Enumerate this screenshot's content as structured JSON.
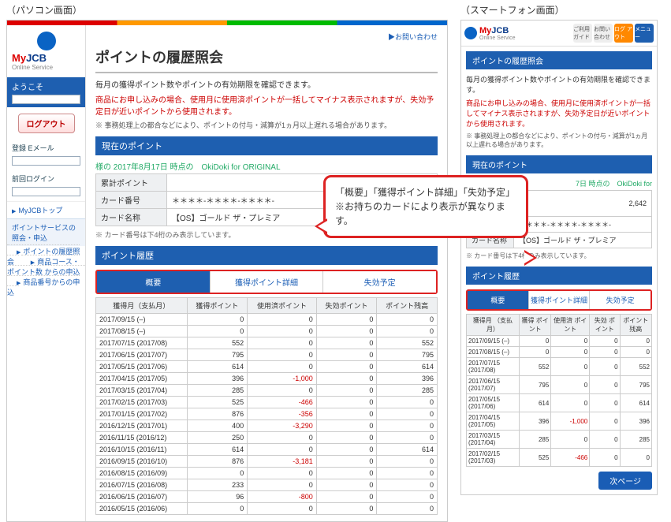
{
  "labels": {
    "pc": "（パソコン画面）",
    "sp": "（スマートフォン画面）"
  },
  "logo": {
    "brand_my": "My",
    "brand_jcb": "JCB",
    "sub": "Online Service"
  },
  "side": {
    "welcome": "ようこそ",
    "logout": "ログアウト",
    "email": "登録 Eメール",
    "last_login": "前回ログイン",
    "top": "MyJCBトップ",
    "point_service": "ポイントサービスの\n照会・申込",
    "links": [
      "ポイントの履歴照会",
      "商品コース・ポイント数\nからの申込",
      "商品番号からの申込"
    ]
  },
  "crumb": "▶お問い合わせ",
  "title": "ポイントの履歴照会",
  "lead": "毎月の獲得ポイント数やポイントの有効期限を確認できます。",
  "warn": "商品にお申し込みの場合、使用月に使用済ポイントが一括してマイナス表示されますが、失効予定日が近いポイントから使用されます。",
  "warn_sp": "商品にお申し込みの場合、使用月に使用済ポイントが一括してマイナス表示されますが、失効予定日が近いポイントから使用されます。",
  "note": "※ 事務処理上の都合などにより、ポイントの付与・減算が1ヵ月以上遅れる場合があります。",
  "sec_current": "現在のポイント",
  "card_line": "様の 2017年8月17日 時点の　OkiDoki for ORIGINAL",
  "card_line_sp": "7日 時点の　OkiDoki for",
  "card": {
    "rows": [
      {
        "k": "累計ポイント",
        "v": "2,642"
      },
      {
        "k": "カード番号",
        "v": "＊＊＊＊-＊＊＊＊-＊＊＊＊-"
      },
      {
        "k": "カード名称",
        "v": "【OS】ゴールド ザ・プレミア"
      }
    ],
    "note": "※ カード番号は下4桁のみ表示しています。"
  },
  "sec_history": "ポイント履歴",
  "tabs": [
    "概要",
    "獲得ポイント詳細",
    "失効予定"
  ],
  "cols": [
    "獲得月（支払月）",
    "獲得ポイント",
    "使用済ポイント",
    "失効ポイント",
    "ポイント残高"
  ],
  "cols_sp": [
    "獲得月\n（支払月）",
    "獲得\nポイント",
    "使用済\nポイント",
    "失効\nポイント",
    "ポイント\n残高"
  ],
  "rows": [
    [
      "2017/09/15 (–)",
      "0",
      "0",
      "0",
      "0"
    ],
    [
      "2017/08/15 (–)",
      "0",
      "0",
      "0",
      "0"
    ],
    [
      "2017/07/15 (2017/08)",
      "552",
      "0",
      "0",
      "552"
    ],
    [
      "2017/06/15 (2017/07)",
      "795",
      "0",
      "0",
      "795"
    ],
    [
      "2017/05/15 (2017/06)",
      "614",
      "0",
      "0",
      "614"
    ],
    [
      "2017/04/15 (2017/05)",
      "396",
      "-1,000",
      "0",
      "396"
    ],
    [
      "2017/03/15 (2017/04)",
      "285",
      "0",
      "0",
      "285"
    ],
    [
      "2017/02/15 (2017/03)",
      "525",
      "-466",
      "0",
      "0"
    ],
    [
      "2017/01/15 (2017/02)",
      "876",
      "-356",
      "0",
      "0"
    ],
    [
      "2016/12/15 (2017/01)",
      "400",
      "-3,290",
      "0",
      "0"
    ],
    [
      "2016/11/15 (2016/12)",
      "250",
      "0",
      "0",
      "0"
    ],
    [
      "2016/10/15 (2016/11)",
      "614",
      "0",
      "0",
      "614"
    ],
    [
      "2016/09/15 (2016/10)",
      "876",
      "-3,181",
      "0",
      "0"
    ],
    [
      "2016/08/15 (2016/09)",
      "0",
      "0",
      "0",
      "0"
    ],
    [
      "2016/07/15 (2016/08)",
      "233",
      "0",
      "0",
      "0"
    ],
    [
      "2016/06/15 (2016/07)",
      "96",
      "-800",
      "0",
      "0"
    ],
    [
      "2016/05/15 (2016/06)",
      "0",
      "0",
      "0",
      "0"
    ]
  ],
  "rows_sp": [
    [
      "2017/09/15\n(–)",
      "0",
      "0",
      "0",
      "0"
    ],
    [
      "2017/08/15\n(–)",
      "0",
      "0",
      "0",
      "0"
    ],
    [
      "2017/07/15\n(2017/08)",
      "552",
      "0",
      "0",
      "552"
    ],
    [
      "2017/06/15\n(2017/07)",
      "795",
      "0",
      "0",
      "795"
    ],
    [
      "2017/05/15\n(2017/06)",
      "614",
      "0",
      "0",
      "614"
    ],
    [
      "2017/04/15\n(2017/05)",
      "396",
      "-1,000",
      "0",
      "396"
    ],
    [
      "2017/03/15\n(2017/04)",
      "285",
      "0",
      "0",
      "285"
    ],
    [
      "2017/02/15\n(2017/03)",
      "525",
      "-466",
      "0",
      "0"
    ]
  ],
  "next": "次ページ",
  "callout": {
    "l1": "「概要」「獲得ポイント詳細」「失効予定」",
    "l2": "※お持ちのカードにより表示が異なります。"
  },
  "sp_icons": [
    "ご利用\nガイド",
    "お問い\n合わせ",
    "ログ\nアウト",
    "メニュー"
  ]
}
